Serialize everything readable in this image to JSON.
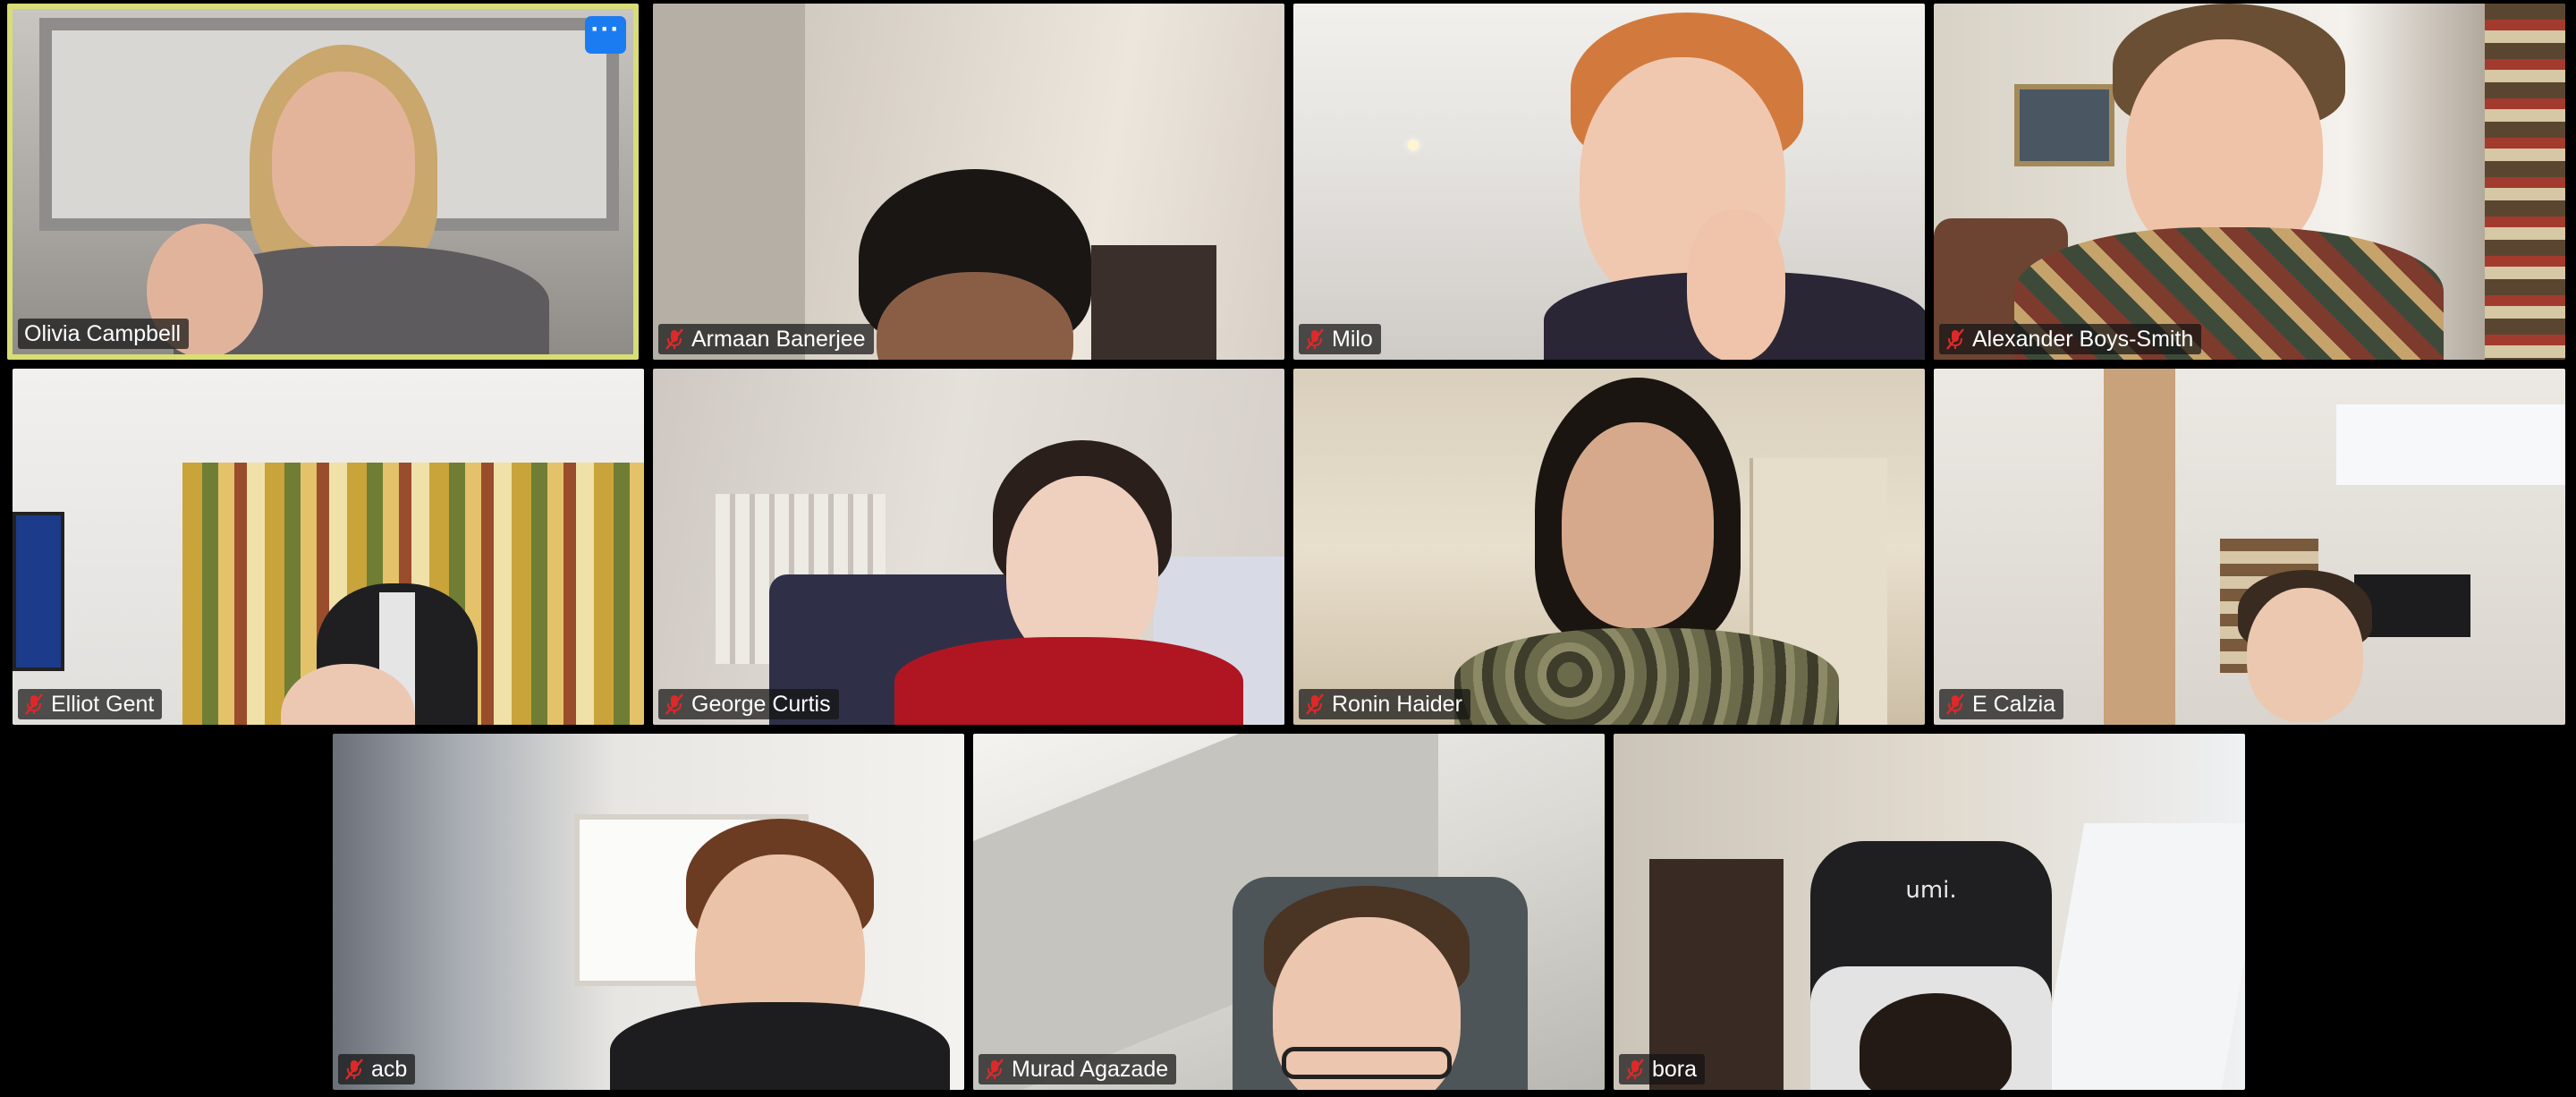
{
  "window": {
    "title": ""
  },
  "tiles": [
    {
      "id": "olivia",
      "name": "Olivia Campbell",
      "muted": false,
      "active": true,
      "options_label": "···"
    },
    {
      "id": "armaan",
      "name": "Armaan Banerjee",
      "muted": true
    },
    {
      "id": "milo",
      "name": "Milo",
      "muted": true
    },
    {
      "id": "alexander",
      "name": "Alexander Boys-Smith",
      "muted": true
    },
    {
      "id": "elliot",
      "name": "Elliot Gent",
      "muted": true
    },
    {
      "id": "george",
      "name": "George Curtis",
      "muted": true
    },
    {
      "id": "ronin",
      "name": "Ronin Haider",
      "muted": true
    },
    {
      "id": "ecalzia",
      "name": "E Calzia",
      "muted": true
    },
    {
      "id": "acb",
      "name": "acb",
      "muted": true
    },
    {
      "id": "murad",
      "name": "Murad Agazade",
      "muted": true
    },
    {
      "id": "bora",
      "name": "bora",
      "muted": true
    }
  ],
  "backgrounds": {
    "chair_logo": "umi."
  },
  "colors": {
    "active_speaker_border": "#d9dd75",
    "options_button": "#1b7cf2",
    "muted_icon": "#e02828",
    "gallery_background": "#000000"
  },
  "icons": {
    "muted": "mic-off-icon",
    "options": "more-options-icon"
  }
}
